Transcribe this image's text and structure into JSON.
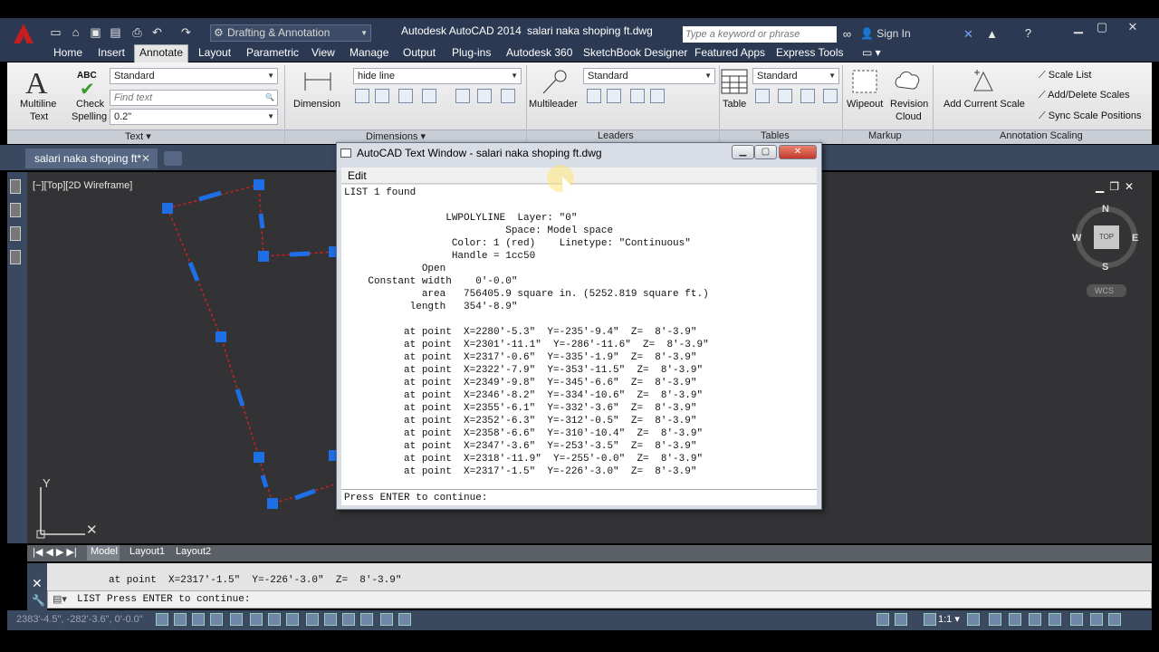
{
  "titlebar": {
    "workspace": "Drafting & Annotation",
    "product": "Autodesk AutoCAD 2014",
    "file": "salari naka shoping ft.dwg",
    "search_placeholder": "Type a keyword or phrase",
    "signin": "Sign In"
  },
  "tabs": [
    "Home",
    "Insert",
    "Annotate",
    "Layout",
    "Parametric",
    "View",
    "Manage",
    "Output",
    "Plug-ins",
    "Autodesk 360",
    "SketchBook Designer",
    "Featured Apps",
    "Express Tools"
  ],
  "ribbon": {
    "multiline_text": [
      "Multiline",
      "Text"
    ],
    "check_spelling": [
      "Check",
      "Spelling"
    ],
    "abc": "ABC",
    "text_style": "Standard",
    "find_text_placeholder": "Find text",
    "text_height": "0.2\"",
    "text_panel": "Text",
    "dimension": "Dimension",
    "dim_style": "hide line",
    "dimensions_panel": "Dimensions",
    "multileader": "Multileader",
    "leader_style": "Standard",
    "leaders_panel": "Leaders",
    "table": "Table",
    "table_style": "Standard",
    "tables_panel": "Tables",
    "wipeout": "Wipeout",
    "revision_cloud": [
      "Revision",
      "Cloud"
    ],
    "markup_panel": "Markup",
    "add_current_scale": "Add Current Scale",
    "scale_list": "Scale List",
    "add_delete_scales": "Add/Delete Scales",
    "sync_scale_positions": "Sync Scale Positions",
    "annotation_scaling_panel": "Annotation Scaling"
  },
  "doc_tab": "salari naka shoping ft*",
  "viewport_label": "[−][Top][2D Wireframe]",
  "viewcube": {
    "n": "N",
    "s": "S",
    "e": "E",
    "w": "W",
    "top": "TOP",
    "wcs": "WCS"
  },
  "layout_tabs": [
    "Model",
    "Layout1",
    "Layout2"
  ],
  "command": {
    "history_line": "at point  X=2317'-1.5\"  Y=-226'-3.0\"  Z=  8'-3.9\"",
    "input": "LIST Press ENTER to continue:"
  },
  "status": {
    "coords": "2383'-4.5\", -282'-3.6\", 0'-0.0\"",
    "scale": "1:1"
  },
  "text_window": {
    "title": "AutoCAD Text Window - salari naka shoping ft.dwg",
    "menu_edit": "Edit",
    "body": "LIST 1 found\n\n                 LWPOLYLINE  Layer: \"0\"\n                           Space: Model space\n                  Color: 1 (red)    Linetype: \"Continuous\"\n                  Handle = 1cc50\n             Open\n    Constant width    0'-0.0\"\n             area   756405.9 square in. (5252.819 square ft.)\n           length   354'-8.9\"\n\n          at point  X=2280'-5.3\"  Y=-235'-9.4\"  Z=  8'-3.9\"\n          at point  X=2301'-11.1\"  Y=-286'-11.6\"  Z=  8'-3.9\"\n          at point  X=2317'-0.6\"  Y=-335'-1.9\"  Z=  8'-3.9\"\n          at point  X=2322'-7.9\"  Y=-353'-11.5\"  Z=  8'-3.9\"\n          at point  X=2349'-9.8\"  Y=-345'-6.6\"  Z=  8'-3.9\"\n          at point  X=2346'-8.2\"  Y=-334'-10.6\"  Z=  8'-3.9\"\n          at point  X=2355'-6.1\"  Y=-332'-3.6\"  Z=  8'-3.9\"\n          at point  X=2352'-6.3\"  Y=-312'-0.5\"  Z=  8'-3.9\"\n          at point  X=2358'-6.6\"  Y=-310'-10.4\"  Z=  8'-3.9\"\n          at point  X=2347'-3.6\"  Y=-253'-3.5\"  Z=  8'-3.9\"\n          at point  X=2318'-11.9\"  Y=-255'-0.0\"  Z=  8'-3.9\"\n          at point  X=2317'-1.5\"  Y=-226'-3.0\"  Z=  8'-3.9\"",
    "prompt": "Press ENTER to continue:"
  },
  "colors": {
    "accent": "#2b3a52",
    "polyline": "#cc2222",
    "grip": "#1e6fe6"
  }
}
